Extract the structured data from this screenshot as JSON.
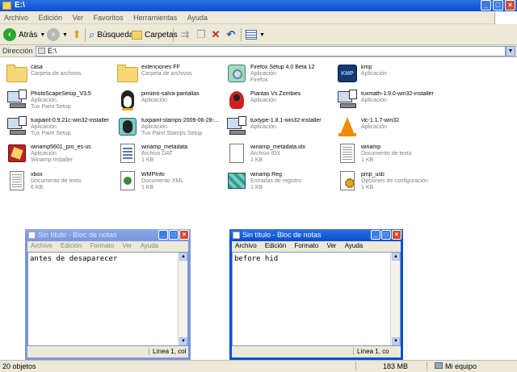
{
  "window": {
    "title": "E:\\"
  },
  "menu": [
    "Archivo",
    "Edición",
    "Ver",
    "Favoritos",
    "Herramientas",
    "Ayuda"
  ],
  "toolbar": {
    "back_label": "Atrás",
    "search_label": "Búsqueda",
    "folders_label": "Carpetas"
  },
  "address": {
    "label": "Dirección",
    "value": "E:\\"
  },
  "files": [
    {
      "name": "casa",
      "type": "Carpeta de archivos",
      "info": "",
      "icon": "folder-icon"
    },
    {
      "name": "extenciones FF",
      "type": "Carpeta de archivos",
      "info": "",
      "icon": "folder-icon"
    },
    {
      "name": "Firefox Setup 4.0 Beta 12",
      "type": "Aplicación",
      "info": "Firefox",
      "icon": "installer-icon"
    },
    {
      "name": "kmp",
      "type": "Aplicación",
      "info": "",
      "icon": "kmplayer-icon"
    },
    {
      "name": "PhotoScapeSetup_V3.5",
      "type": "Aplicación",
      "info": "Tux Paint Setup",
      "icon": "computer-installer-icon"
    },
    {
      "name": "pinüino-salva-pantallas",
      "type": "Aplicación",
      "info": "",
      "icon": "penguin-icon"
    },
    {
      "name": "Plantas Vs Zombies",
      "type": "Aplicación",
      "info": "",
      "icon": "game-icon"
    },
    {
      "name": "tuxmath-1.9.0-win32-installer",
      "type": "Aplicación",
      "info": "",
      "icon": "computer-installer-icon"
    },
    {
      "name": "tuxpaint-0.9.21c-win32-installer",
      "type": "Aplicación",
      "info": "Tux Paint Setup",
      "icon": "computer-installer-icon"
    },
    {
      "name": "tuxpaint-stamps-2009-06-28-...",
      "type": "Aplicación",
      "info": "Tux Paint Stamps Setup",
      "icon": "stamps-icon"
    },
    {
      "name": "tuxtype-1.8.1-win32-installer",
      "type": "Aplicación",
      "info": "",
      "icon": "computer-installer-icon"
    },
    {
      "name": "vlc-1.1.7-win32",
      "type": "Aplicación",
      "info": "",
      "icon": "vlc-cone-icon"
    },
    {
      "name": "winamp5601_pro_es-us",
      "type": "Aplicación",
      "info": "Winamp Installer",
      "icon": "winamp-installer-icon"
    },
    {
      "name": "winamp_metadata",
      "type": "Archivo DAT",
      "info": "1 KB",
      "icon": "dat-file-icon"
    },
    {
      "name": "winamp_metadata.idx",
      "type": "Archivo IDX",
      "info": "1 KB",
      "icon": "blank-file-icon"
    },
    {
      "name": "winamp",
      "type": "Documento de texto",
      "info": "1 KB",
      "icon": "text-file-icon"
    },
    {
      "name": "xbox",
      "type": "Documento de texto",
      "info": "6 KB",
      "icon": "text-file-icon"
    },
    {
      "name": "WMPInfo",
      "type": "Documento XML",
      "info": "1 KB",
      "icon": "xml-file-icon"
    },
    {
      "name": "winamp Reg",
      "type": "Entradas de registro",
      "info": "1 KB",
      "icon": "registry-file-icon"
    },
    {
      "name": "pmp_usb",
      "type": "Opciones de configuración",
      "info": "1 KB",
      "icon": "config-file-icon"
    }
  ],
  "notepad_left": {
    "title": "Sin título - Bloc de notas",
    "menu": [
      "Archivo",
      "Edición",
      "Formato",
      "Ver",
      "Ayuda"
    ],
    "text": "antes de desaparecer",
    "status": "Línea 1, col"
  },
  "notepad_right": {
    "title": "Sin título - Bloc de notas",
    "menu": [
      "Archivo",
      "Edición",
      "Formato",
      "Ver",
      "Ayuda"
    ],
    "text": "before hid",
    "status": "Línea 1, co"
  },
  "status": {
    "objects": "20 objetos",
    "size": "183 MB",
    "location": "Mi equipo"
  }
}
